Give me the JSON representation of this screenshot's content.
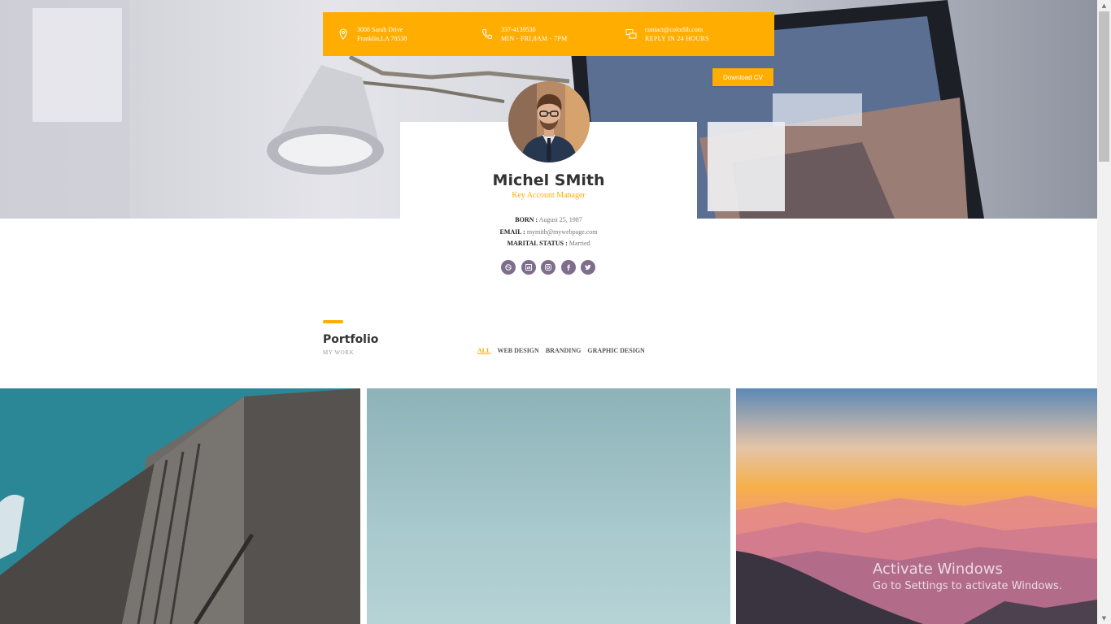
{
  "contact": {
    "address": {
      "line1": "3008 Sarah Drive",
      "line2": "Franklin,LA 70538",
      "icon": "location-pin-icon"
    },
    "phone": {
      "line1": "337-4139538",
      "line2": "MIN - FRI,8AM - 7PM",
      "icon": "phone-icon"
    },
    "email": {
      "line1": "contact@colorlib.com",
      "line2": "REPLY IN 24 HOURS",
      "icon": "chat-icon"
    }
  },
  "download_label": "Download CV",
  "profile": {
    "name": "Michel SMith",
    "role": "Key Account Manager",
    "born_label": "BORN :",
    "born_value": "August 25, 1987",
    "email_label": "EMAIL :",
    "email_value": "mymith@mywebpage.com",
    "marital_label": "MARITAL STATUS :",
    "marital_value": "Married"
  },
  "socials": [
    {
      "icon": "dribbble-icon"
    },
    {
      "icon": "linkedin-icon"
    },
    {
      "icon": "instagram-icon"
    },
    {
      "icon": "facebook-icon"
    },
    {
      "icon": "twitter-icon"
    }
  ],
  "portfolio": {
    "title": "Portfolio",
    "subtitle": "MY WORK",
    "filters": [
      "ALL",
      "WEB DESIGN",
      "BRANDING",
      "GRAPHIC DESIGN"
    ],
    "active_filter": "ALL"
  },
  "watermark": {
    "title": "Activate Windows",
    "subtitle": "Go to Settings to activate Windows."
  },
  "colors": {
    "accent": "#ffad00",
    "social": "#7e6d8c"
  }
}
